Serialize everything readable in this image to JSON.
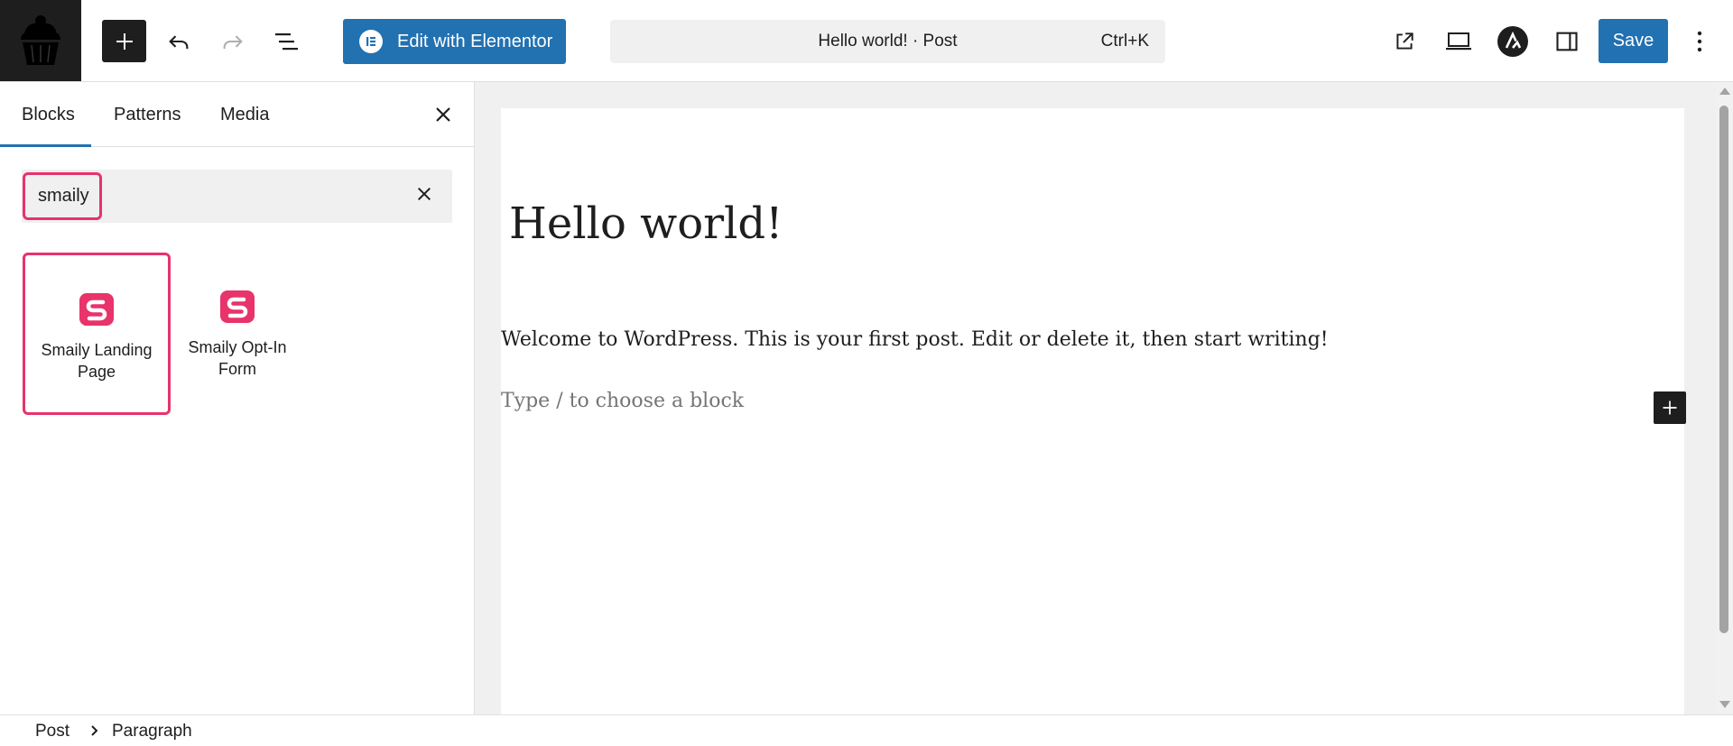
{
  "toolbar": {
    "inserter_icon": "plus-icon",
    "undo_icon": "undo-icon",
    "redo_icon": "redo-icon",
    "list_view_icon": "list-view-icon",
    "elementor_label": "Edit with Elementor",
    "document_title": "Hello world! · Post",
    "command_shortcut": "Ctrl+K",
    "save_label": "Save",
    "accent_color": "#2271b1"
  },
  "inserter": {
    "tabs": [
      {
        "label": "Blocks",
        "active": true
      },
      {
        "label": "Patterns",
        "active": false
      },
      {
        "label": "Media",
        "active": false
      }
    ],
    "search": {
      "value": "smaily",
      "placeholder": ""
    },
    "results": [
      {
        "label": "Smaily Landing Page",
        "icon": "smaily-icon",
        "highlighted": true
      },
      {
        "label": "Smaily Opt-In Form",
        "icon": "smaily-icon",
        "highlighted": false
      }
    ],
    "highlight_color": "#e6336c",
    "brand_color": "#e8336b"
  },
  "editor": {
    "post_title": "Hello world!",
    "paragraph": "Welcome to WordPress. This is your first post. Edit or delete it, then start writing!",
    "placeholder": "Type / to choose a block"
  },
  "breadcrumb": {
    "items": [
      "Post",
      "Paragraph"
    ]
  }
}
